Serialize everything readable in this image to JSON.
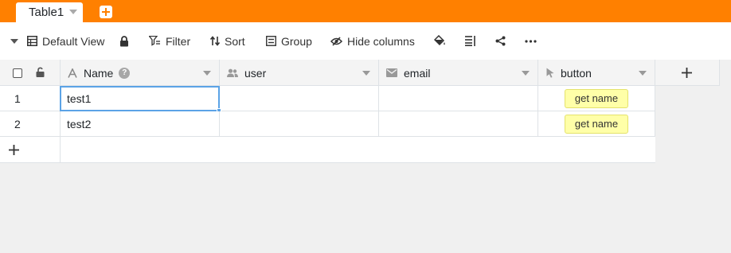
{
  "colors": {
    "header_bar": "#ff8000",
    "selection": "#5ba3e6",
    "button_bg": "#ffffa8"
  },
  "tabs": [
    {
      "label": "Table1",
      "icon": "caret-down-icon"
    }
  ],
  "add_table_icon": "plus-square-icon",
  "toolbar": {
    "view_label": "Default View",
    "filter_label": "Filter",
    "sort_label": "Sort",
    "group_label": "Group",
    "hide_columns_label": "Hide columns",
    "icons": [
      "caret-down-icon",
      "table-icon",
      "lock-icon",
      "filter-icon",
      "sort-icon",
      "group-icon",
      "eye-slash-icon",
      "paint-bucket-icon",
      "row-height-icon",
      "share-icon",
      "more-icon"
    ]
  },
  "columns": [
    {
      "name": "Name",
      "icon": "text-a-icon",
      "has_help": true
    },
    {
      "name": "user",
      "icon": "users-icon"
    },
    {
      "name": "email",
      "icon": "mail-icon"
    },
    {
      "name": "button",
      "icon": "pointer-icon"
    }
  ],
  "rows": [
    {
      "index": "1",
      "name": "test1",
      "user": "",
      "email": "",
      "button": "get name"
    },
    {
      "index": "2",
      "name": "test2",
      "user": "",
      "email": "",
      "button": "get name"
    }
  ],
  "add_row_icon": "plus-icon",
  "add_column_icon": "plus-icon"
}
